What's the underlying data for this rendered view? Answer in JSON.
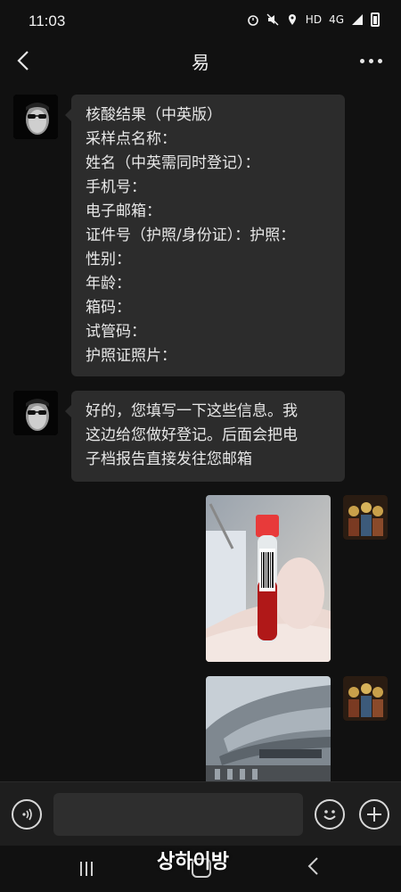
{
  "status": {
    "time": "11:03",
    "network": "HD",
    "signal": "4G"
  },
  "header": {
    "title": "易"
  },
  "messages": [
    {
      "from": "contact",
      "lines": [
        "核酸结果（中英版）",
        "采样点名称：",
        "姓名（中英需同时登记）：",
        "手机号：",
        "电子邮箱：",
        "证件号（护照/身份证）：护照：",
        "性别：",
        "年龄：",
        "箱码：",
        "试管码：",
        "护照证照片："
      ]
    },
    {
      "from": "contact",
      "lines": [
        "好的，您填写一下这些信息。我",
        "这边给您做好登记。后面会把电",
        "子档报告直接发往您邮箱"
      ]
    },
    {
      "from": "self",
      "type": "photo",
      "subject": "test-tube-photo"
    },
    {
      "from": "self",
      "type": "photo",
      "subject": "building-photo"
    }
  ],
  "watermark": "상하이방",
  "colors": {
    "background": "#111111",
    "bubble": "#2c2c2c",
    "tube_cap": "#e83a3a",
    "blood": "#b01818"
  }
}
